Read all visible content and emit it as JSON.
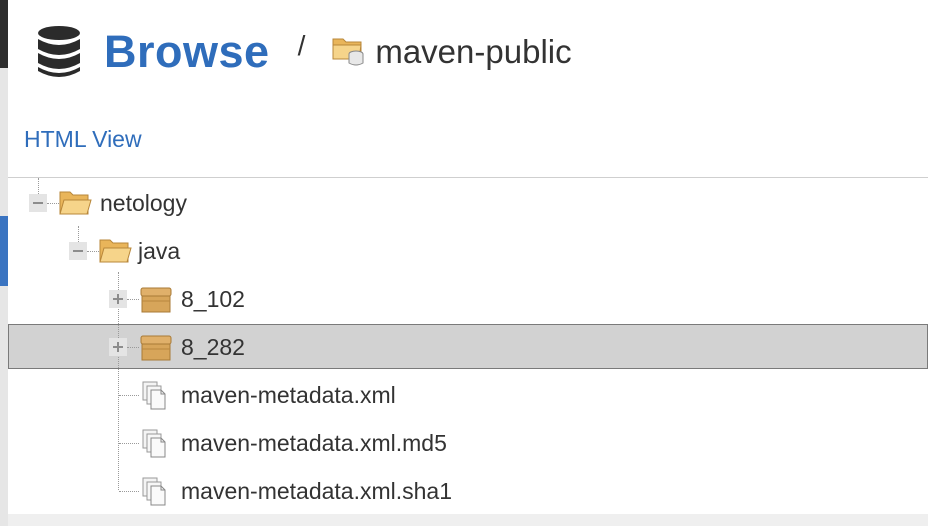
{
  "header": {
    "title": "Browse",
    "separator": "/",
    "repository": "maven-public"
  },
  "toolbar": {
    "html_view_label": "HTML View"
  },
  "tree": {
    "nodes": [
      {
        "label": "netology",
        "type": "folder",
        "expanded": true
      },
      {
        "label": "java",
        "type": "folder",
        "expanded": true
      },
      {
        "label": "8_102",
        "type": "component",
        "expanded": false
      },
      {
        "label": "8_282",
        "type": "component",
        "expanded": false,
        "selected": true
      },
      {
        "label": "maven-metadata.xml",
        "type": "file"
      },
      {
        "label": "maven-metadata.xml.md5",
        "type": "file"
      },
      {
        "label": "maven-metadata.xml.sha1",
        "type": "file"
      }
    ]
  },
  "colors": {
    "accent": "#2f6dbb",
    "selected_row": "#d2d2d2",
    "folder": "#f2c46d",
    "component": "#d7a55a"
  },
  "icons": {
    "header": "database-icon",
    "repository": "repository-icon",
    "folder": "folder-open-icon",
    "component": "component-box-icon",
    "file": "file-stack-icon"
  }
}
